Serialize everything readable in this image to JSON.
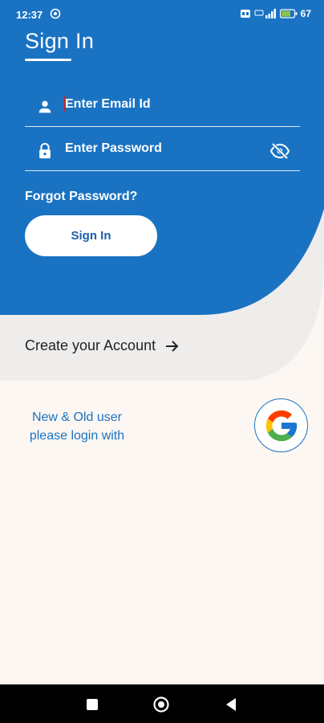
{
  "status_bar": {
    "time": "12:37",
    "battery": "67"
  },
  "signin": {
    "title": "Sign In",
    "email_placeholder": "Enter Email Id",
    "password_placeholder": "Enter Password",
    "forgot_label": "Forgot Password?",
    "button_label": "Sign In"
  },
  "create_account": {
    "label": "Create your Account"
  },
  "google": {
    "text_line1": "New & Old user",
    "text_line2": "please login with"
  },
  "icons": {
    "email_field": "person-icon",
    "password_field": "lock-icon",
    "password_toggle": "eye-off-icon",
    "create_account": "arrow-right-icon",
    "google": "google-logo",
    "nav": [
      "square-icon",
      "circle-icon",
      "back-triangle-icon"
    ]
  },
  "colors": {
    "primary": "#1a73c2",
    "background": "#fcf7f3",
    "band": "#efedec"
  }
}
